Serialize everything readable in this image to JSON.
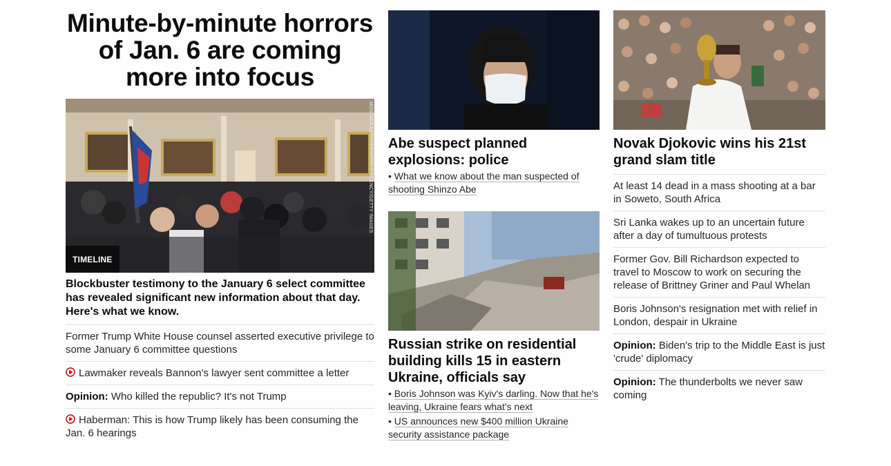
{
  "left": {
    "headline": "Minute-by-minute horrors of Jan. 6 are coming more into focus",
    "image_tag": "TIMELINE",
    "image_credit": "MOSTAFA BASSIM/ANADOLU AGENCY/GETTY IMAGES",
    "lead": "Blockbuster testimony to the January 6 select committee has revealed significant new information about that day. Here's what we know.",
    "items": [
      {
        "prefix": "",
        "text": "Former Trump White House counsel asserted executive privilege to some January 6 committee questions",
        "video": false
      },
      {
        "prefix": "",
        "text": "Lawmaker reveals Bannon's lawyer sent committee a letter",
        "video": true
      },
      {
        "prefix": "Opinion:",
        "text": " Who killed the republic? It's not Trump",
        "video": false
      },
      {
        "prefix": "",
        "text": "Haberman: This is how Trump likely has been consuming the Jan. 6 hearings",
        "video": true
      }
    ]
  },
  "middle": {
    "story1": {
      "title": "Abe suspect planned explosions: police",
      "links": [
        "What we know about the man suspected of shooting Shinzo Abe"
      ]
    },
    "story2": {
      "title": "Russian strike on residential building kills 15 in eastern Ukraine, officials say",
      "links": [
        "Boris Johnson was Kyiv's darling. Now that he's leaving, Ukraine fears what's next",
        "US announces new $400 million Ukraine security assistance package"
      ]
    }
  },
  "right": {
    "title": "Novak Djokovic wins his 21st grand slam title",
    "items": [
      {
        "prefix": "",
        "text": "At least 14 dead in a mass shooting at a bar in Soweto, South Africa"
      },
      {
        "prefix": "",
        "text": "Sri Lanka wakes up to an uncertain future after a day of tumultuous protests"
      },
      {
        "prefix": "",
        "text": "Former Gov. Bill Richardson expected to travel to Moscow to work on securing the release of Brittney Griner and Paul Whelan"
      },
      {
        "prefix": "",
        "text": "Boris Johnson's resignation met with relief in London, despair in Ukraine"
      },
      {
        "prefix": "Opinion:",
        "text": " Biden's trip to the Middle East is just 'crude' diplomacy"
      },
      {
        "prefix": "Opinion:",
        "text": " The thunderbolts we never saw coming"
      }
    ]
  },
  "colors": {
    "video_icon": "#cc0000",
    "tag_bg": "#0c0c0c",
    "divider": "#e0e0e0"
  }
}
